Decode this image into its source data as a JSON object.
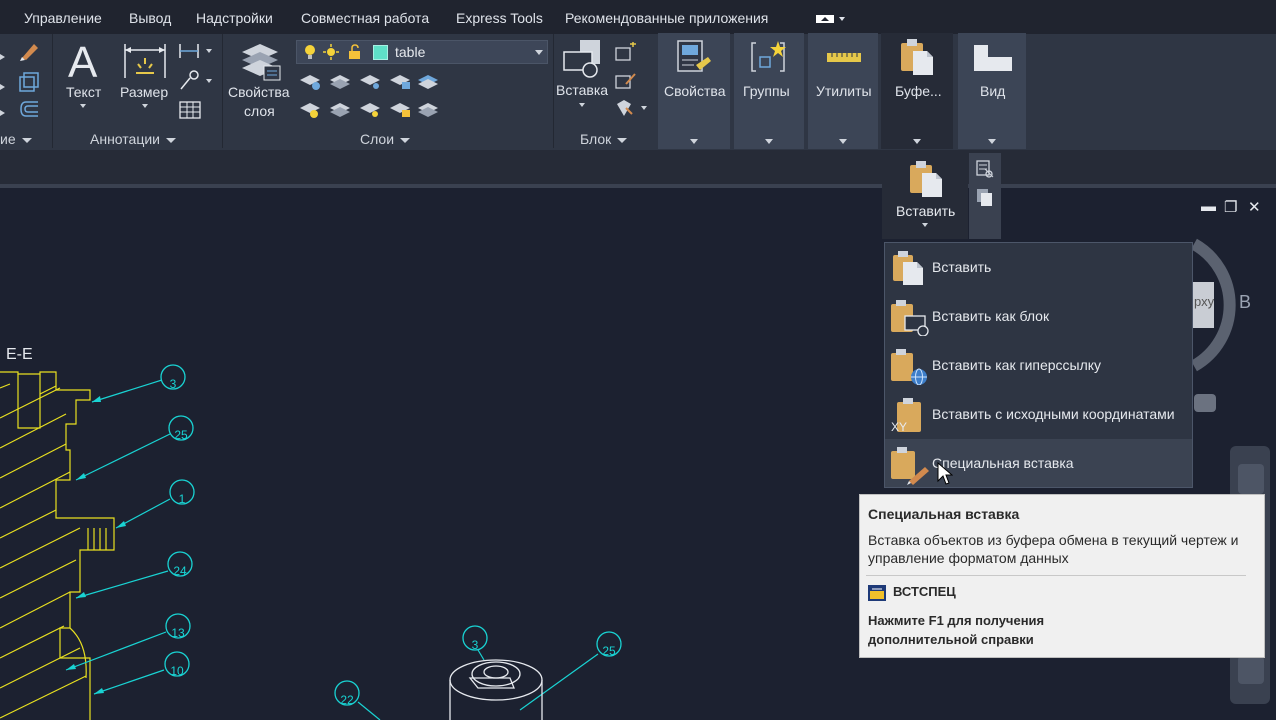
{
  "menu": [
    "Управление",
    "Вывод",
    "Надстройки",
    "Совместная работа",
    "Express Tools",
    "Рекомендованные приложения"
  ],
  "ribbon": {
    "text_label": "Текст",
    "dimension_label": "Размер",
    "annotations_title": "Аннотации",
    "partial_title": "ие",
    "layer_props_line1": "Свойства",
    "layer_props_line2": "слоя",
    "layer_name": "table",
    "layers_title": "Слои",
    "insert_label": "Вставка",
    "block_title": "Блок",
    "properties_label": "Свойства",
    "groups_label": "Группы",
    "utilities_label": "Утилиты",
    "clipboard_label": "Буфе...",
    "view_label": "Вид"
  },
  "flyout": {
    "paste_label": "Вставить"
  },
  "paste_menu": [
    {
      "label": "Вставить",
      "icon": "paste-icon"
    },
    {
      "label": "Вставить как блок",
      "icon": "paste-as-block-icon"
    },
    {
      "label": "Вставить как гиперссылку",
      "icon": "paste-as-hyperlink-icon"
    },
    {
      "label": "Вставить с исходными координатами",
      "icon": "paste-original-coordinates-icon",
      "badge": "XY"
    },
    {
      "label": "Специальная вставка",
      "icon": "paste-special-icon"
    }
  ],
  "tooltip": {
    "title": "Специальная вставка",
    "desc_line1": "Вставка объектов из буфера обмена в текущий чертеж и",
    "desc_line2": "управление форматом данных",
    "command": "ВСТСПЕЦ",
    "help_line1": "Нажмите F1 для получения",
    "help_line2": "дополнительной справки"
  },
  "drawing": {
    "section_label": "E-E",
    "balloons": [
      "3",
      "25",
      "1",
      "24",
      "13",
      "10",
      "3",
      "25",
      "22"
    ],
    "viewcube_partial": "В",
    "viewcube_face_partial": "рху"
  },
  "colors": {
    "accent_cyan": "#19d3d3",
    "hatch_yellow": "#e8e020",
    "paste_icon": "#d9a95c"
  }
}
